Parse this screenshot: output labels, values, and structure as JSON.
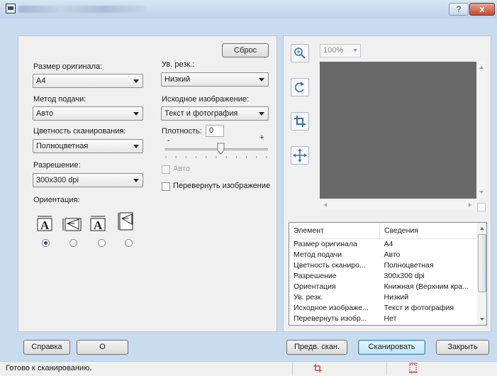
{
  "window": {
    "help_glyph": "?",
    "close_glyph": "x"
  },
  "left": {
    "reset_label": "Сброс",
    "original_size": {
      "label": "Размер оригинала:",
      "value": "A4"
    },
    "feed_method": {
      "label": "Метод подачи:",
      "value": "Авто"
    },
    "color_mode": {
      "label": "Цветность сканирования:",
      "value": "Полноцветная"
    },
    "resolution": {
      "label": "Разрешение:",
      "value": "300x300 dpi"
    },
    "orientation_label": "Ориентация:",
    "sharpness": {
      "label": "Ув. резк.:",
      "value": "Низкий"
    },
    "source_image": {
      "label": "Исходное изображение:",
      "value": "Текст и фотография"
    },
    "density": {
      "label": "Плотность:",
      "value": "0",
      "minus": "-",
      "plus": "+",
      "level": 0.5
    },
    "auto_label": "Авто",
    "rotate_label": "Перевернуть изображение",
    "orientation_selected_index": 0
  },
  "preview": {
    "zoom_value": "100%",
    "info_headers": [
      "Элемент",
      "Сведения"
    ],
    "info_rows": [
      [
        "Размер оригинала",
        "A4"
      ],
      [
        "Метод подачи",
        "Авто"
      ],
      [
        "Цветность сканиро...",
        "Полноцветная"
      ],
      [
        "Разрешение",
        "300x300 dpi"
      ],
      [
        "Ориентация",
        "Книжная (Верхним кра..."
      ],
      [
        "Ув. резк.",
        "Низкий"
      ],
      [
        "Исходное изображе...",
        "Текст и фотография"
      ],
      [
        "Перевернуть изобр...",
        "Нет"
      ]
    ]
  },
  "buttons": {
    "help": "Справка",
    "about": "О",
    "prescan": "Предв. скан.",
    "scan": "Сканировать",
    "close": "Закрыть"
  },
  "status": {
    "text": "Готово к сканированию."
  },
  "colors": {
    "preview_bg": "#696969",
    "accent": "#3c7fb1"
  },
  "icons": [
    "zoom-in-icon",
    "rotate-icon",
    "crop-icon",
    "move-icon",
    "portrait-orientation-icon",
    "landscape-orientation-icon"
  ]
}
